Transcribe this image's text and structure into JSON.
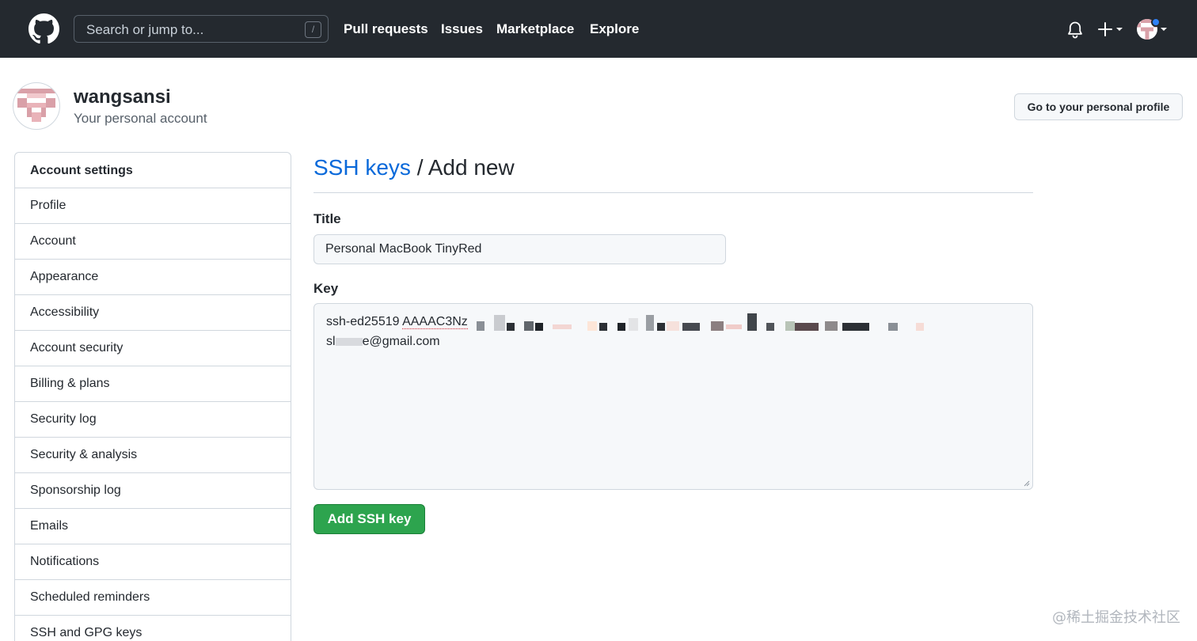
{
  "header": {
    "search_placeholder": "Search or jump to...",
    "search_shortcut": "/",
    "nav": [
      "Pull requests",
      "Issues",
      "Marketplace",
      "Explore"
    ]
  },
  "account": {
    "name": "wangsansi",
    "subtitle": "Your personal account",
    "profile_button": "Go to your personal profile"
  },
  "sidebar": {
    "heading": "Account settings",
    "items": [
      "Profile",
      "Account",
      "Appearance",
      "Accessibility",
      "Account security",
      "Billing & plans",
      "Security log",
      "Security & analysis",
      "Sponsorship log",
      "Emails",
      "Notifications",
      "Scheduled reminders",
      "SSH and GPG keys"
    ]
  },
  "main": {
    "breadcrumb_link": "SSH keys",
    "breadcrumb_sep": " / ",
    "breadcrumb_current": "Add new",
    "title_label": "Title",
    "title_value": "Personal MacBook TinyRed",
    "key_label": "Key",
    "key_line1_a": "ssh-ed25519 ",
    "key_line1_b": "AAAAC3Nz",
    "key_line2_a": "sl",
    "key_line2_b": "e@gmail.com",
    "submit": "Add SSH key"
  },
  "watermark": "@稀土掘金技术社区",
  "colors": {
    "header_bg": "#24292f",
    "link": "#0969da",
    "primary_button": "#2da44e",
    "notification_dot": "#2f81f7",
    "avatar_pink": "#d9a0a8"
  },
  "icons": {
    "logo": "github-mark-icon",
    "bell": "bell-icon",
    "plus": "plus-icon",
    "caret": "caret-down-icon"
  }
}
